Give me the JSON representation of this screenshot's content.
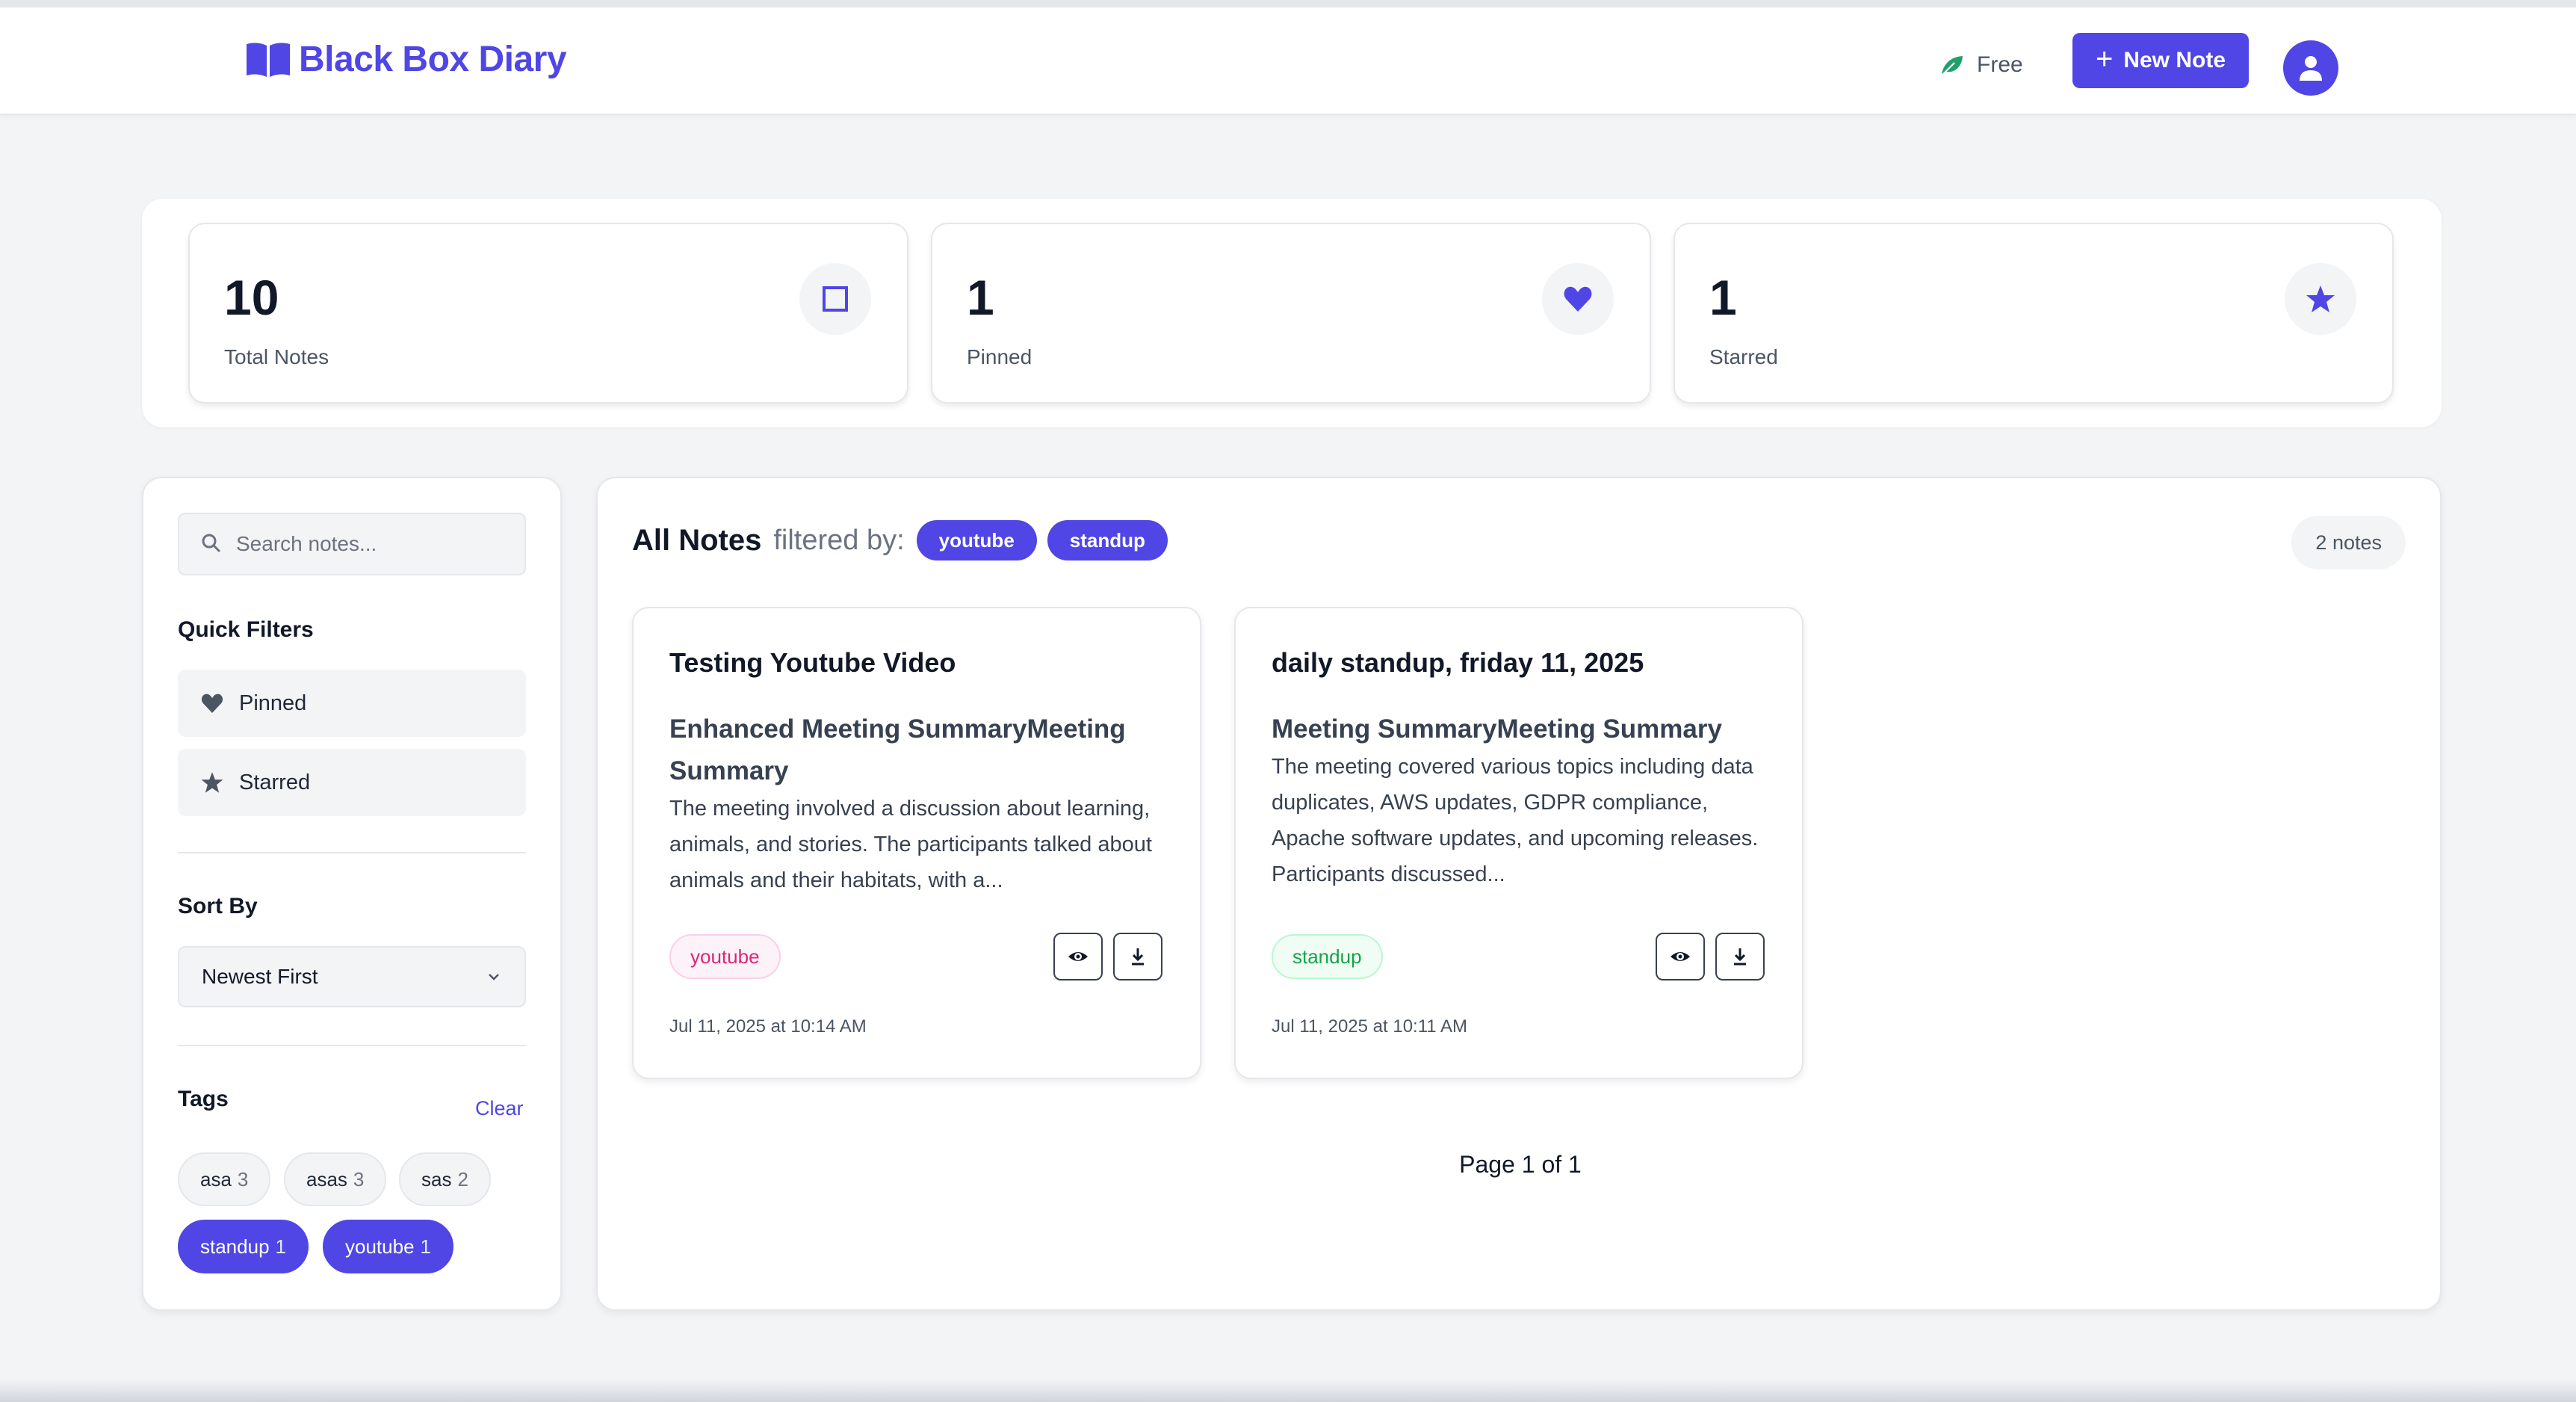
{
  "header": {
    "brand": "Black Box Diary",
    "plan": "Free",
    "new_note": "New Note"
  },
  "stats": [
    {
      "value": "10",
      "label": "Total Notes",
      "icon": "square-icon"
    },
    {
      "value": "1",
      "label": "Pinned",
      "icon": "heart-icon"
    },
    {
      "value": "1",
      "label": "Starred",
      "icon": "star-icon"
    }
  ],
  "sidebar": {
    "search_placeholder": "Search notes...",
    "quick_filters_title": "Quick Filters",
    "quick_filters": [
      "Pinned",
      "Starred"
    ],
    "sort_title": "Sort By",
    "sort_value": "Newest First",
    "tags_title": "Tags",
    "clear": "Clear",
    "tags": [
      {
        "name": "asa",
        "count": "3",
        "active": false
      },
      {
        "name": "asas",
        "count": "3",
        "active": false
      },
      {
        "name": "sas",
        "count": "2",
        "active": false
      },
      {
        "name": "standup",
        "count": "1",
        "active": true
      },
      {
        "name": "youtube",
        "count": "1",
        "active": true
      }
    ]
  },
  "main": {
    "title": "All Notes",
    "filtered_by": "filtered by:",
    "filters": [
      "youtube",
      "standup"
    ],
    "count": "2 notes",
    "notes": [
      {
        "title": "Testing Youtube Video",
        "subtitle": "Enhanced Meeting SummaryMeeting Summary",
        "body": "The meeting involved a discussion about learning, animals, and stories. The participants talked about animals and their habitats, with a...",
        "tag": "youtube",
        "date": "Jul 11, 2025 at 10:14 AM"
      },
      {
        "title": "daily standup, friday 11, 2025",
        "subtitle": "Meeting SummaryMeeting Summary",
        "body": "The meeting covered various topics including data duplicates, AWS updates, GDPR compliance, Apache software updates, and upcoming releases. Participants discussed...",
        "tag": "standup",
        "date": "Jul 11, 2025 at 10:11 AM"
      }
    ],
    "pager": "Page 1 of 1"
  },
  "colors": {
    "accent": "#4f46e5",
    "background": "#f3f4f6",
    "leaf": "#22a06b",
    "tag_pink": "#db2777",
    "tag_green": "#16a34a"
  }
}
